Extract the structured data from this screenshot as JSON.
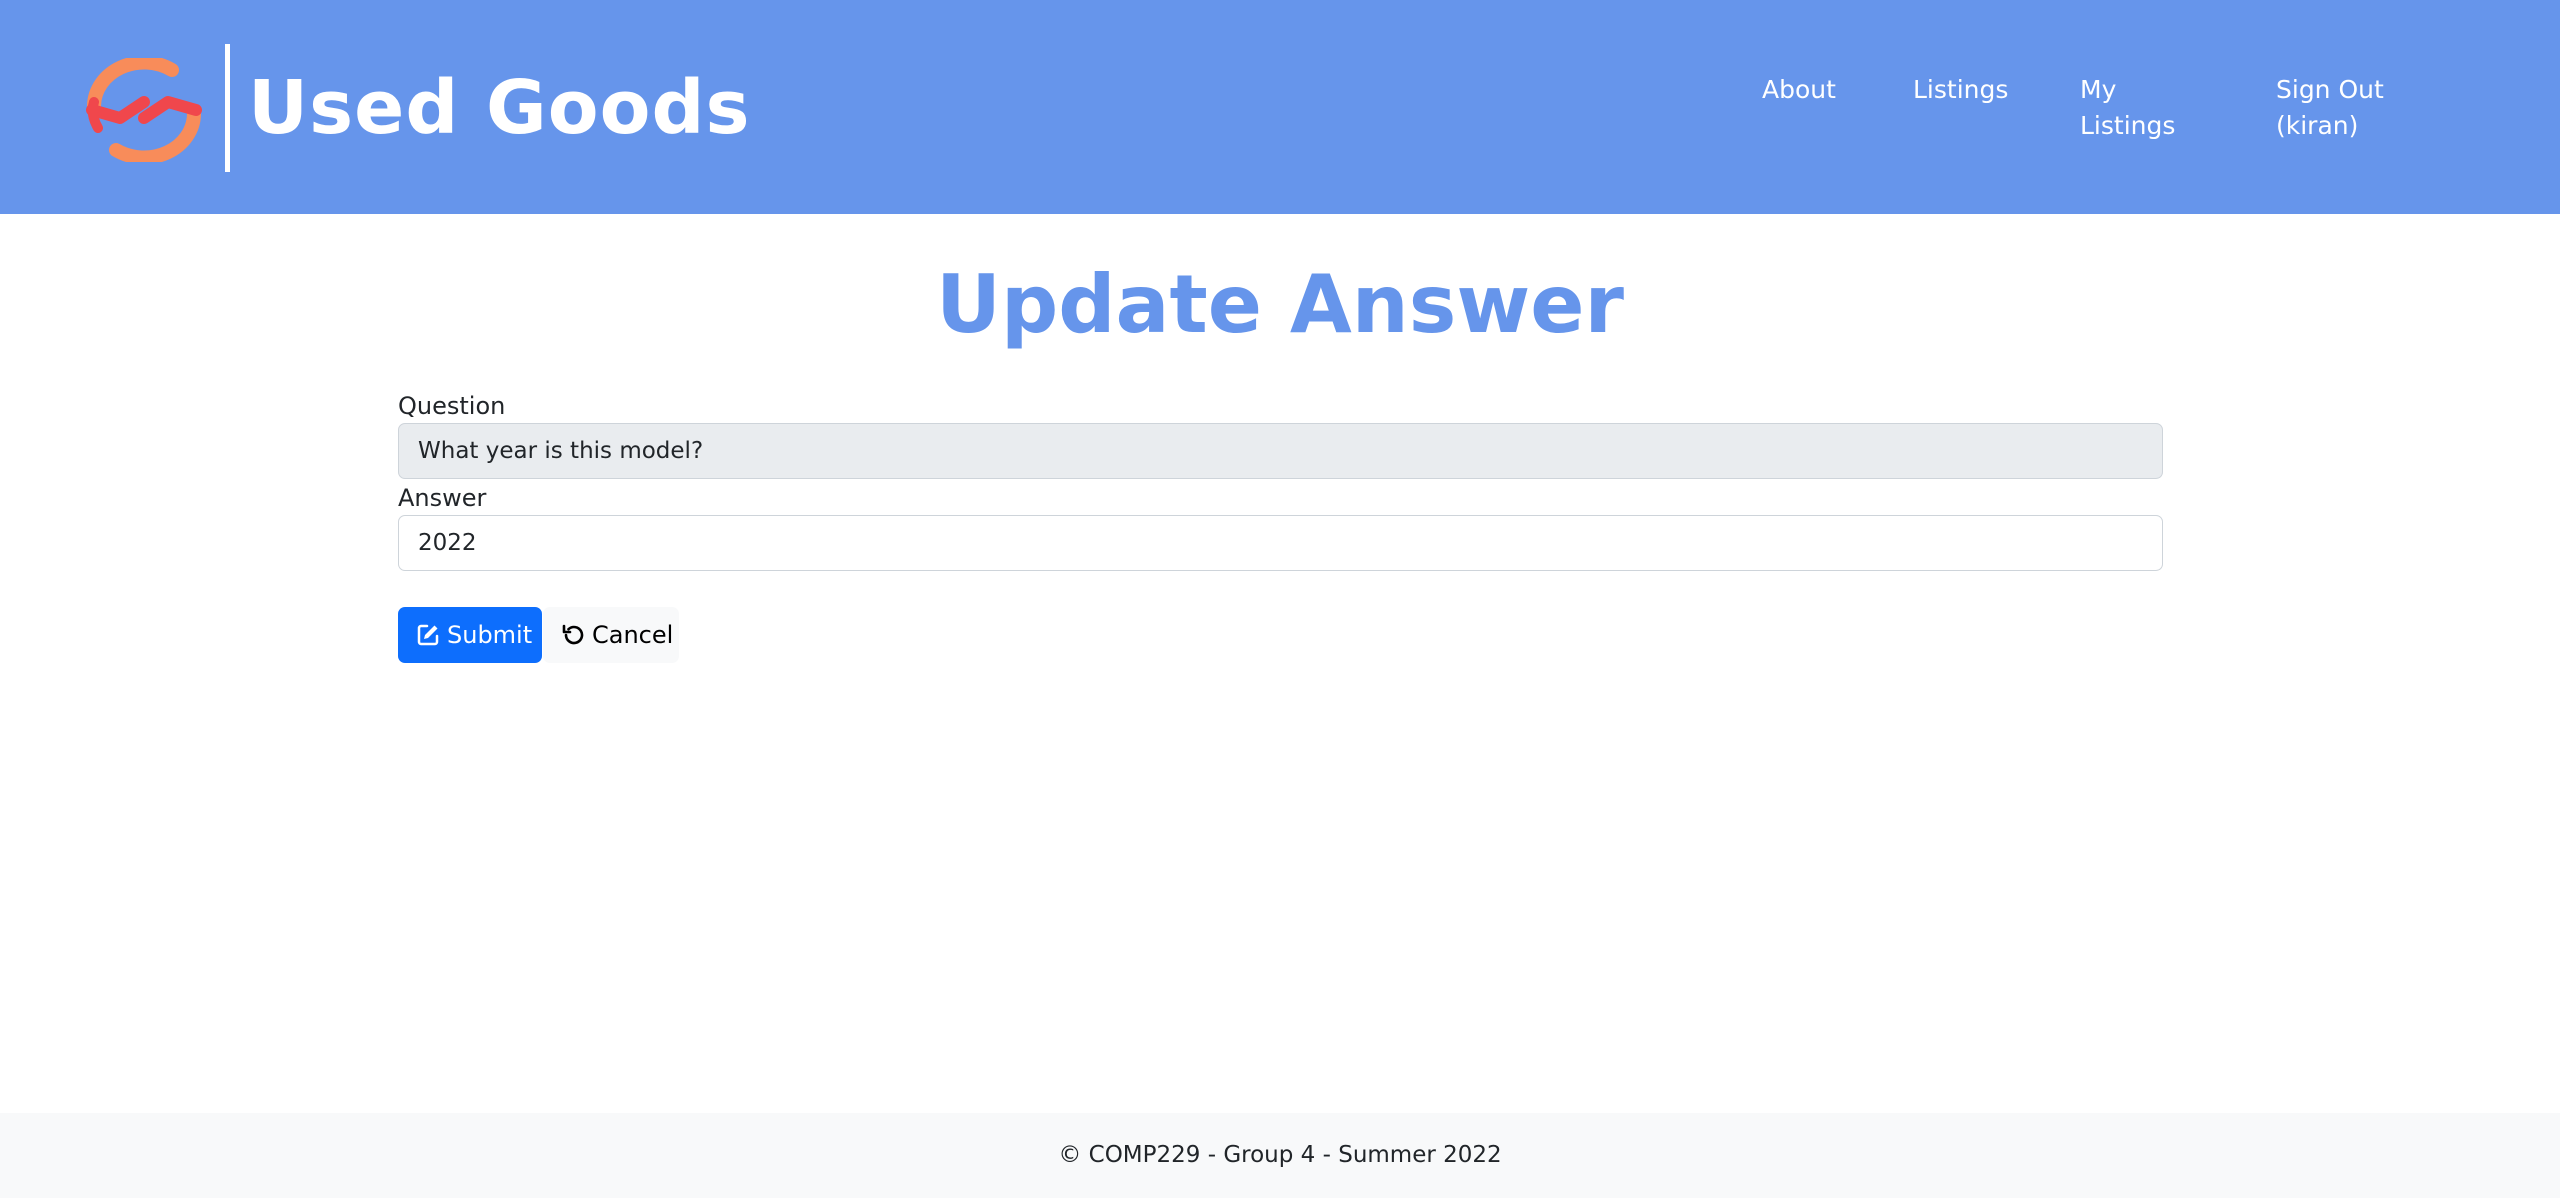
{
  "header": {
    "brand_name": "Used Goods",
    "nav": {
      "about": "About",
      "listings": "Listings",
      "my_listings": "My Listings",
      "sign_out": "Sign Out (kiran)"
    }
  },
  "main": {
    "title": "Update Answer",
    "question_label": "Question",
    "question_value": "What year is this model?",
    "answer_label": "Answer",
    "answer_value": "2022",
    "submit_label": "Submit",
    "cancel_label": "Cancel"
  },
  "footer": {
    "text": "© COMP229 - Group 4 - Summer 2022"
  },
  "colors": {
    "header_bg": "#6695eb",
    "title": "#6695eb",
    "submit_bg": "#0d6efd",
    "logo_red": "#f0474c",
    "logo_orange": "#f88c5a"
  },
  "icons": {
    "logo": "recycle-arrows-icon",
    "submit": "edit-icon",
    "cancel": "undo-icon"
  }
}
